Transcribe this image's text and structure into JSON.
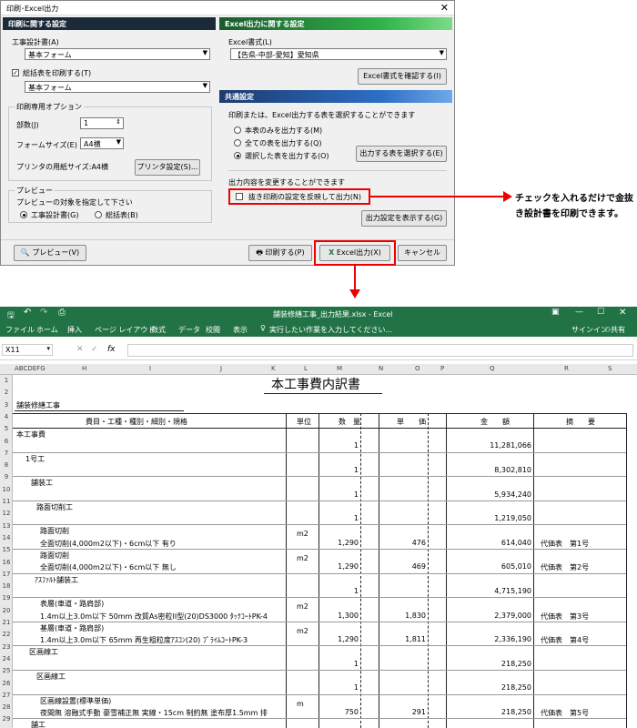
{
  "dialog": {
    "title": "印刷･Excel出力",
    "print_panel": {
      "header": "印刷に関する設定",
      "design_doc_label": "工事設計書(A)",
      "design_doc_value": "基本フォーム",
      "summary_label": "総括表を印刷する(T)",
      "summary_value": "基本フォーム",
      "options_title": "印刷専用オプション",
      "copies_label": "部数(J)",
      "copies_value": "1",
      "form_size_label": "フォームサイズ(E)",
      "form_size_value": "A4横",
      "paper_size_text": "プリンタの用紙サイズ:A4横",
      "printer_settings_btn": "プリンタ設定(S)...",
      "preview_title": "プレビュー",
      "preview_desc": "プレビューの対象を指定して下さい",
      "radio_design": "工事設計書(G)",
      "radio_summary": "総括表(B)"
    },
    "excel_panel": {
      "header": "Excel出力に関する設定",
      "format_label": "Excel書式(L)",
      "format_value": "【告県-中部-愛知】愛知県",
      "confirm_btn": "Excel書式を確認する(I)"
    },
    "common_panel": {
      "header": "共通設定",
      "desc": "印刷または、Excel出力する表を選択することができます",
      "radio_main": "本表のみを出力する(M)",
      "radio_all": "全ての表を出力する(Q)",
      "radio_selected": "選択した表を出力する(O)",
      "select_btn": "出力する表を選択する(E)",
      "change_desc": "出力内容を変更することができます",
      "deduct_label": "抜き印刷の設定を反映して出力(N)",
      "show_settings_btn": "出力設定を表示する(G)"
    },
    "footer": {
      "preview_btn": "プレビュー(V)",
      "print_btn": "印刷する(P)",
      "excel_btn": "Excel出力(X)",
      "cancel_btn": "キャンセル"
    }
  },
  "callout": "チェックを入れるだけで金抜き設計書を印刷できます。",
  "excel": {
    "title": "舗装修繕工事_出力結果.xlsx - Excel",
    "menu": [
      "ファイル",
      "ホーム",
      "挿入",
      "ページ レイアウト",
      "数式",
      "データ",
      "校閲",
      "表示"
    ],
    "tell_me": "実行したい作業を入力してください...",
    "signin": "サインイン",
    "share": "共有",
    "name_box": "X11",
    "fx": "fx",
    "col_headers": [
      "ABCDEFG",
      "H",
      "I",
      "J",
      "K",
      "L",
      "M",
      "N",
      "O",
      "P",
      "Q",
      "R",
      "S"
    ],
    "row_numbers": [
      "1",
      "2",
      "3",
      "4",
      "5",
      "6",
      "7",
      "8",
      "9",
      "10",
      "11",
      "12",
      "13",
      "14",
      "15",
      "16",
      "17",
      "18",
      "19",
      "20",
      "21",
      "22",
      "23",
      "24",
      "25",
      "26",
      "27",
      "28",
      "29"
    ],
    "doc_title": "本工事費内訳書",
    "project": "舗装修繕工事",
    "headers": {
      "item": "費目・工種・種別・細別・規格",
      "unit": "単位",
      "qty": "数　量",
      "price": "単　　価",
      "amount": "金　　額",
      "note": "摘　　要"
    },
    "rows": [
      {
        "label": "本工事費",
        "qty": "1",
        "price": "",
        "amount": "11,281,066",
        "note": "",
        "unit": ""
      },
      {
        "label": "1号工",
        "qty": "1",
        "price": "",
        "amount": "8,302,810",
        "note": "",
        "unit": ""
      },
      {
        "label": "舗装工",
        "qty": "1",
        "price": "",
        "amount": "5,934,240",
        "note": "",
        "unit": ""
      },
      {
        "label": "路面切削工",
        "qty": "1",
        "price": "",
        "amount": "1,219,050",
        "note": "",
        "unit": ""
      },
      {
        "label": "路面切削",
        "label2": "全面切削(4,000m2以下)・6cm以下 有り",
        "unit": "m2",
        "qty": "1,290",
        "price": "476",
        "amount": "614,040",
        "note": "代価表　第1号"
      },
      {
        "label": "路面切削",
        "label2": "全面切削(4,000m2以下)・6cm以下 無し",
        "unit": "m2",
        "qty": "1,290",
        "price": "469",
        "amount": "605,010",
        "note": "代価表　第2号"
      },
      {
        "label": "ｱｽﾌｧﾙﾄ舗装工",
        "qty": "1",
        "price": "",
        "amount": "4,715,190",
        "note": "",
        "unit": ""
      },
      {
        "label": "表層(車道・路肩部)",
        "label2": "1.4m以上3.0m以下 50mm 改質As密粒II型(20)DS3000 ﾀｯｸｺｰﾄPK-4",
        "unit": "m2",
        "qty": "1,300",
        "price": "1,830",
        "amount": "2,379,000",
        "note": "代価表　第3号"
      },
      {
        "label": "基層(車道・路肩部)",
        "label2": "1.4m以上3.0m以下 65mm 再生粗粒度ｱｽｺﾝ(20) ﾌﾟﾗｲﾑｺｰﾄPK-3",
        "unit": "m2",
        "qty": "1,290",
        "price": "1,811",
        "amount": "2,336,190",
        "note": "代価表　第4号"
      },
      {
        "label": "区画線工",
        "qty": "1",
        "price": "",
        "amount": "218,250",
        "note": "",
        "unit": ""
      },
      {
        "label": "区画線工",
        "qty": "1",
        "price": "",
        "amount": "218,250",
        "note": "",
        "unit": ""
      },
      {
        "label": "区画線設置(標準単価)",
        "label2": "夜間無 溶融式手動 豪雪補正無 実線・15cm 制約無 塗布厚1.5mm 排",
        "unit": "m",
        "qty": "750",
        "price": "291",
        "amount": "218,250",
        "note": "代価表　第5号"
      },
      {
        "label": "舗工",
        "qty": "",
        "price": "",
        "amount": "",
        "note": "",
        "unit": ""
      }
    ]
  },
  "colors": {
    "excel_green": "#217346",
    "highlight": "#e00000"
  }
}
